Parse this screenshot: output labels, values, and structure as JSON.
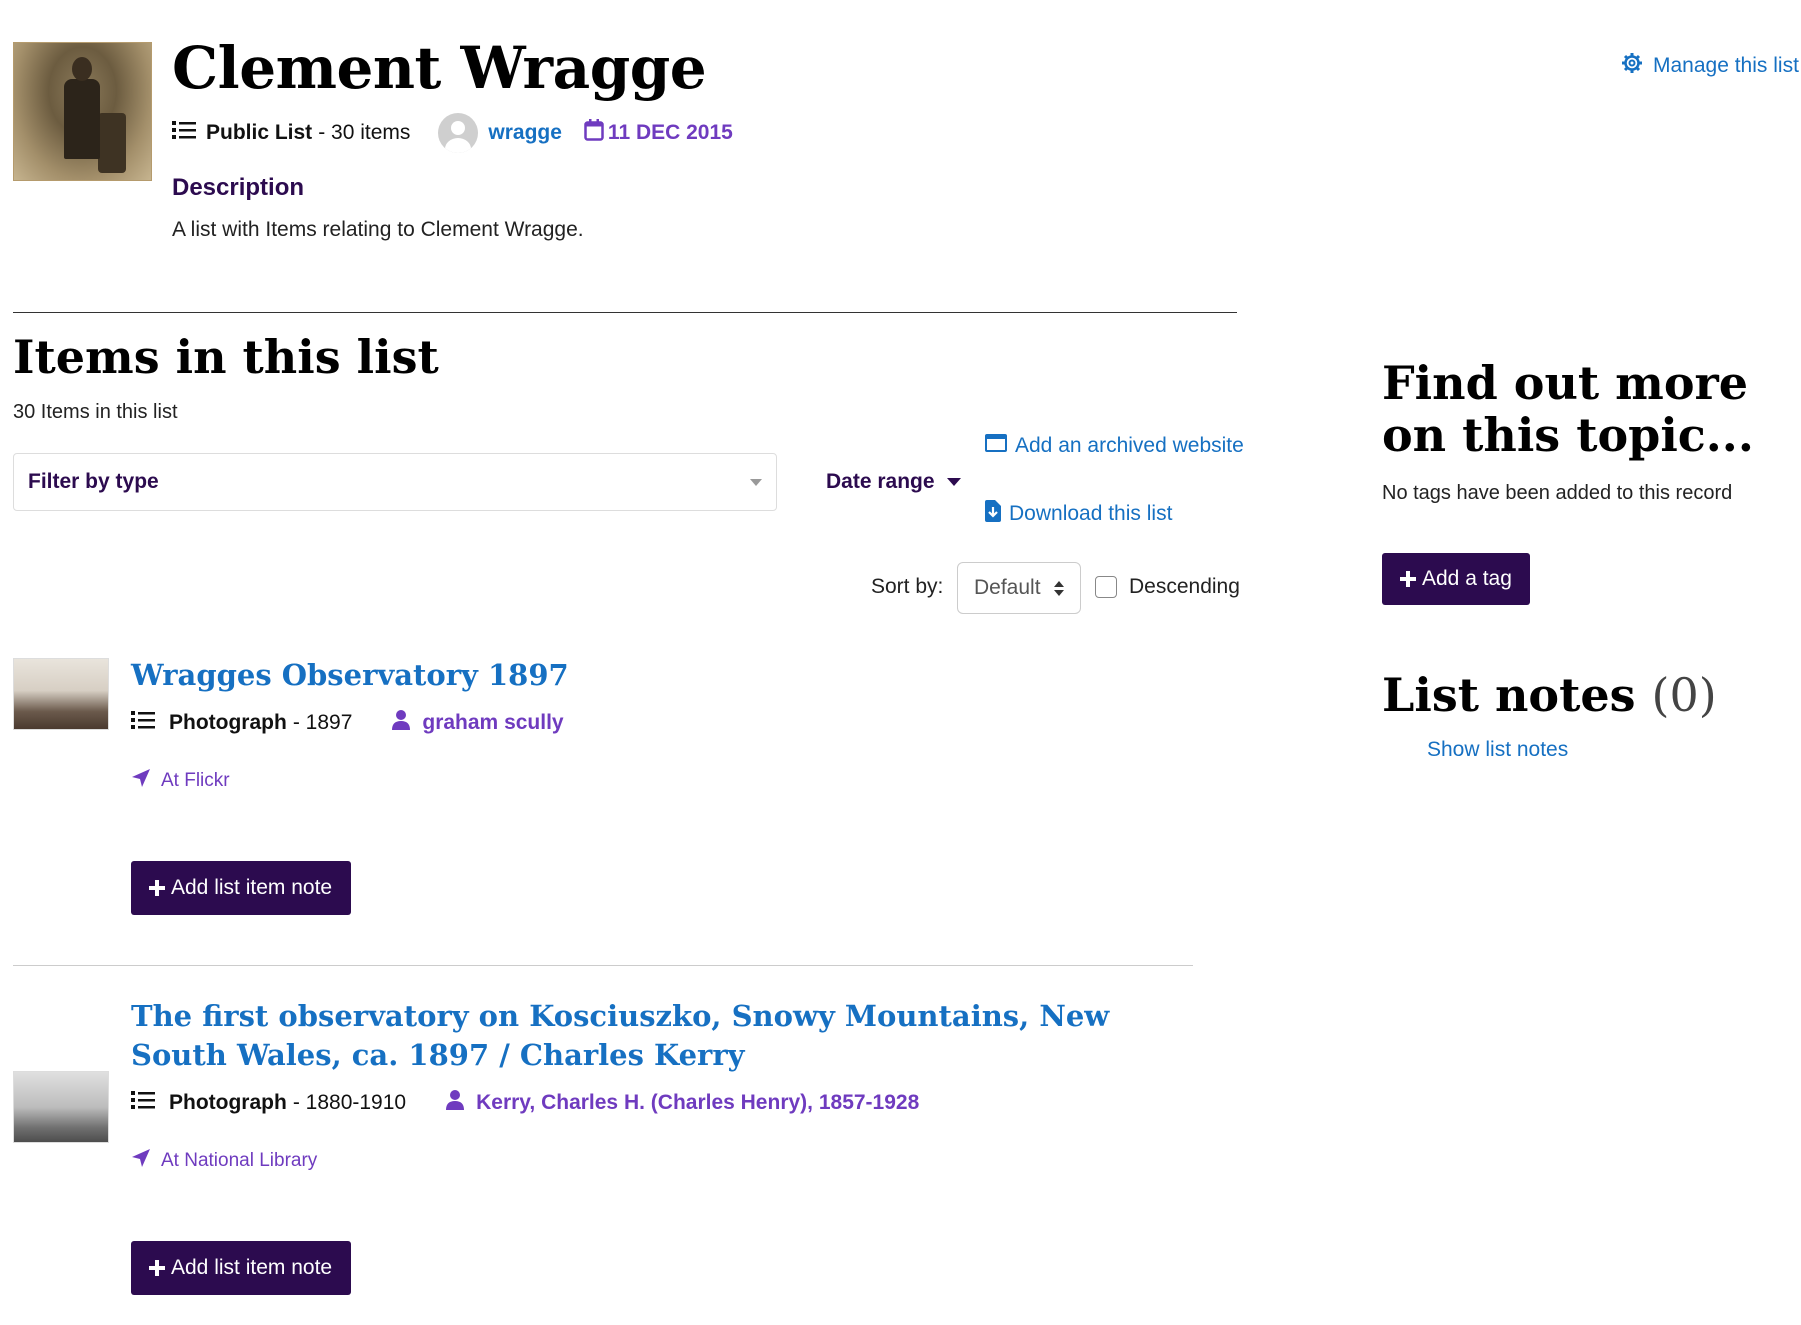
{
  "header": {
    "title": "Clement Wragge",
    "list_type": "Public List",
    "item_count_text": "- 30 items",
    "owner": "wragge",
    "date": "11 DEC 2015",
    "manage_label": "Manage this list",
    "description_heading": "Description",
    "description_text": "A list with Items relating to Clement Wragge."
  },
  "items_section": {
    "heading": "Items in this list",
    "count_text": "30 Items in this list",
    "filter_label": "Filter by type",
    "date_range_label": "Date range",
    "add_archived_label": "Add an archived website",
    "download_label": "Download this list",
    "sort_label": "Sort by:",
    "sort_value": "Default",
    "descending_label": "Descending",
    "descending_checked": false
  },
  "items": [
    {
      "title": "Wragges Observatory 1897",
      "type": "Photograph",
      "date": "- 1897",
      "author": "graham scully",
      "location": "At Flickr",
      "note_button": "Add list item note"
    },
    {
      "title": "The first observatory on Kosciuszko, Snowy Mountains, New South Wales, ca. 1897 / Charles Kerry",
      "type": "Photograph",
      "date": "- 1880-1910",
      "author": "Kerry, Charles H. (Charles Henry), 1857-1928",
      "location": "At National Library",
      "note_button": "Add list item note"
    }
  ],
  "sidebar": {
    "find_heading": "Find out more on this topic...",
    "no_tags_text": "No tags have been added to this record",
    "add_tag_label": "Add a tag",
    "notes_heading": "List notes",
    "notes_count": "(0)",
    "show_notes_label": "Show list notes"
  },
  "colors": {
    "link": "#1670c2",
    "accent_purple": "#6f3bbf",
    "button_dark": "#2c0b4f"
  },
  "icons": [
    "list-icon",
    "avatar-icon",
    "calendar-icon",
    "gear-icon",
    "browser-icon",
    "file-download-icon",
    "user-icon",
    "location-arrow-icon",
    "plus-icon",
    "caret-down-icon",
    "sort-updown-icon"
  ]
}
